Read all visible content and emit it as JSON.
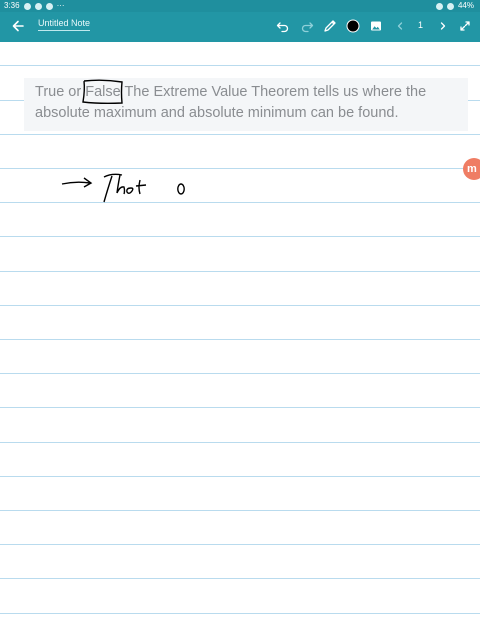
{
  "status_bar": {
    "time": "3:36",
    "more": "···",
    "battery": "44%"
  },
  "app_bar": {
    "back_icon": "arrow-left-icon",
    "title": "Untitled Note",
    "page_number": "1",
    "tools": [
      "undo-icon",
      "redo-icon",
      "pen-icon",
      "color-swatch-black",
      "image-icon",
      "chevron-left-icon",
      "chevron-right-icon",
      "fullscreen-icon"
    ]
  },
  "note": {
    "question": "True or False The Extreme Value Theorem tells us where the absolute maximum and absolute minimum can be found.",
    "handwriting": "→ That o"
  },
  "colors": {
    "app_bar": "#2296a5",
    "status_bar": "#1f8f9e",
    "rule_lines": "#b9dbee",
    "ink": "#000000",
    "bubble": "#ef7d64"
  }
}
